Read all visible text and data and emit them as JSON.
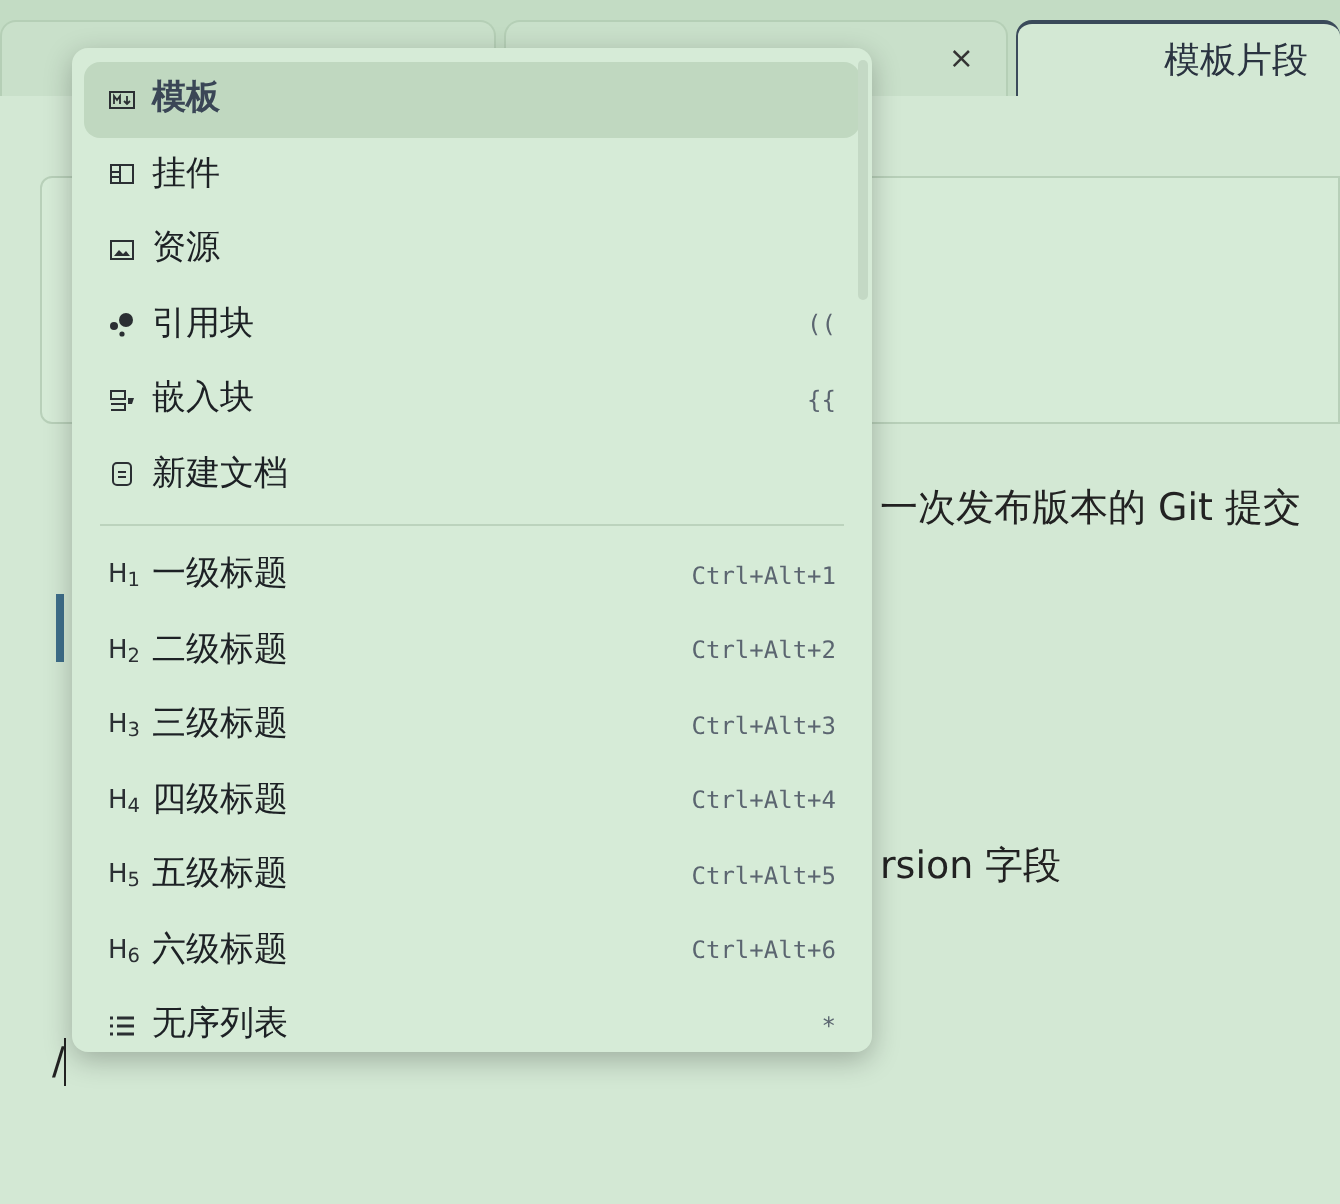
{
  "tabs": [
    {
      "selected": false
    },
    {
      "close": "×",
      "selected": false
    },
    {
      "label": "模板片段",
      "selected": true
    }
  ],
  "editor": {
    "line_1": "一次发布版本的 Git 提交",
    "line_2": "rsion 字段",
    "input": "/"
  },
  "menu": {
    "groups": [
      [
        {
          "label": "模板",
          "selected": true
        },
        {
          "label": "挂件",
          "selected": false
        },
        {
          "label": "资源",
          "selected": false
        },
        {
          "label": "引用块",
          "shortcut": "((",
          "selected": false
        },
        {
          "label": "嵌入块",
          "shortcut": "{{",
          "selected": false
        },
        {
          "label": "新建文档",
          "selected": false
        }
      ],
      [
        {
          "glyph": "H$_{1}$",
          "label": "一级标题",
          "shortcut": "Ctrl+Alt+1",
          "selected": false
        },
        {
          "glyph": "H$_{2}$",
          "label": "二级标题",
          "shortcut": "Ctrl+Alt+2",
          "selected": false
        },
        {
          "glyph": "H$_{3}$",
          "label": "三级标题",
          "shortcut": "Ctrl+Alt+3",
          "selected": false
        },
        {
          "glyph": "H$_{4}$",
          "label": "四级标题",
          "shortcut": "Ctrl+Alt+4",
          "selected": false
        },
        {
          "glyph": "H$_{5}$",
          "label": "五级标题",
          "shortcut": "Ctrl+Alt+5",
          "selected": false
        },
        {
          "glyph": "H$_{6}$",
          "label": "六级标题",
          "shortcut": "Ctrl+Alt+6",
          "selected": false
        },
        {
          "label": "无序列表",
          "shortcut": "*",
          "selected": false
        }
      ]
    ]
  }
}
